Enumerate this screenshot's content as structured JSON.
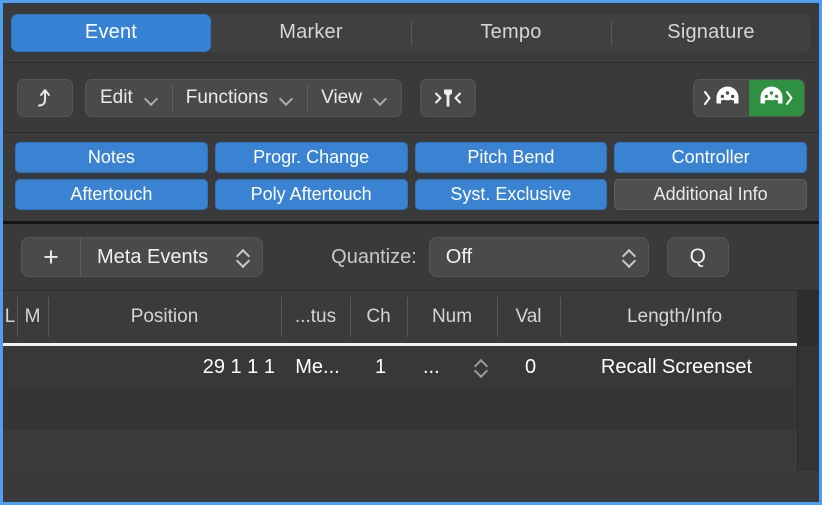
{
  "window": {
    "focus_border_color": "#4e9fef"
  },
  "tabs": [
    {
      "label": "Event",
      "active": true
    },
    {
      "label": "Marker",
      "active": false
    },
    {
      "label": "Tempo",
      "active": false
    },
    {
      "label": "Signature",
      "active": false
    }
  ],
  "toolbar": {
    "hierarchy_up_icon": "arrow-up-curved-icon",
    "menus": [
      {
        "label": "Edit",
        "icon": "chevron-down-icon"
      },
      {
        "label": "Functions",
        "icon": "chevron-down-icon"
      },
      {
        "label": "View",
        "icon": "chevron-down-icon"
      }
    ],
    "catch_playhead_icon": "catch-playhead-pin-icon",
    "midi_in": {
      "icon": "midi-in-icon",
      "active": false,
      "color": "#4a4a4a"
    },
    "midi_out": {
      "icon": "midi-out-icon",
      "active": true,
      "color": "#2e9141"
    }
  },
  "filters": {
    "row1": [
      {
        "label": "Notes",
        "on": true
      },
      {
        "label": "Progr. Change",
        "on": true
      },
      {
        "label": "Pitch Bend",
        "on": true
      },
      {
        "label": "Controller",
        "on": true
      }
    ],
    "row2": [
      {
        "label": "Aftertouch",
        "on": true
      },
      {
        "label": "Poly Aftertouch",
        "on": true
      },
      {
        "label": "Syst. Exclusive",
        "on": true
      },
      {
        "label": "Additional Info",
        "on": false
      }
    ],
    "on_color": "#3a82d2",
    "off_color": "#4f4f4f"
  },
  "metabar": {
    "add_label": "+",
    "event_type": "Meta Events",
    "event_type_icon": "stepper-updown-icon",
    "quantize_label": "Quantize:",
    "quantize_value": "Off",
    "quantize_icon": "stepper-updown-icon",
    "q_button_label": "Q"
  },
  "list": {
    "columns": [
      "L",
      "M",
      "Position",
      "...tus",
      "Ch",
      "Num",
      "Val",
      "Length/Info"
    ],
    "rows": [
      {
        "L": "",
        "M": "",
        "position": "29  1  1      1",
        "status": "Me...",
        "ch": "1",
        "num": "...",
        "num_icon": "stepper-updown-icon",
        "val": "0",
        "length_info": "Recall Screenset"
      }
    ]
  }
}
